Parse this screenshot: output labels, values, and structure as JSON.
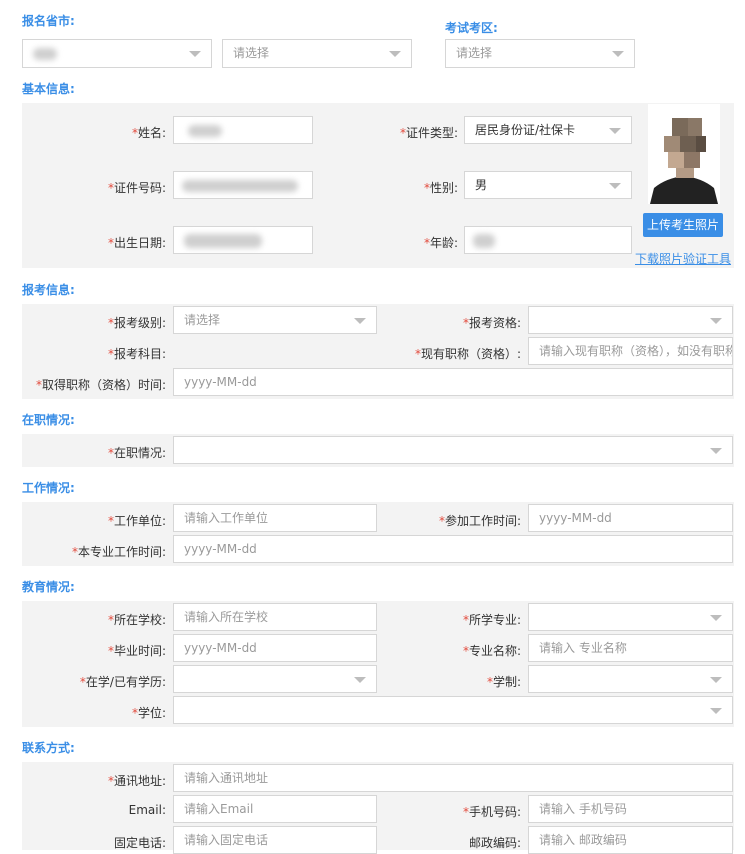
{
  "sections": {
    "province": "报名省市:",
    "exam_area": "考试考区:",
    "basic_info": "基本信息:",
    "exam_info": "报考信息:",
    "employment": "在职情况:",
    "work": "工作情况:",
    "education": "教育情况:",
    "contact": "联系方式:"
  },
  "top": {
    "province_value": "",
    "city_placeholder": "请选择",
    "area_placeholder": "请选择"
  },
  "basic": {
    "name_label": "姓名:",
    "name_value": "",
    "id_type_label": "证件类型:",
    "id_type_value": "居民身份证/社保卡",
    "id_no_label": "证件号码:",
    "id_no_value": "",
    "gender_label": "性别:",
    "gender_value": "男",
    "birth_label": "出生日期:",
    "birth_value": "",
    "age_label": "年龄:",
    "age_value": "",
    "upload_button": "上传考生照片",
    "download_tool_link": "下载照片验证工具"
  },
  "exam": {
    "level_label": "报考级别:",
    "level_placeholder": "请选择",
    "qual_label": "报考资格:",
    "qual_value": "",
    "subject_label": "报考科目:",
    "title_label": "现有职称（资格）:",
    "title_placeholder": "请输入现有职称（资格），如没有职称请填写无",
    "title_time_label": "取得职称（资格）时间:",
    "title_time_placeholder": "yyyy-MM-dd"
  },
  "employment": {
    "status_label": "在职情况:",
    "status_value": ""
  },
  "work": {
    "unit_label": "工作单位:",
    "unit_placeholder": "请输入工作单位",
    "start_label": "参加工作时间:",
    "start_placeholder": "yyyy-MM-dd",
    "major_time_label": "本专业工作时间:",
    "major_time_placeholder": "yyyy-MM-dd"
  },
  "education": {
    "school_label": "所在学校:",
    "school_placeholder": "请输入所在学校",
    "major_label": "所学专业:",
    "major_value": "",
    "grad_label": "毕业时间:",
    "grad_placeholder": "yyyy-MM-dd",
    "major_name_label": "专业名称:",
    "major_name_placeholder": "请输入 专业名称",
    "degree_level_label": "在学/已有学历:",
    "degree_level_value": "",
    "system_label": "学制:",
    "system_value": "",
    "degree_label": "学位:",
    "degree_value": ""
  },
  "contact": {
    "address_label": "通讯地址:",
    "address_placeholder": "请输入通讯地址",
    "email_label": "Email:",
    "email_placeholder": "请输入Email",
    "phone_label": "手机号码:",
    "phone_placeholder": "请输入 手机号码",
    "tel_label": "固定电话:",
    "tel_placeholder": "请输入固定电话",
    "zip_label": "邮政编码:",
    "zip_placeholder": "请输入 邮政编码"
  },
  "required_mark": "*"
}
